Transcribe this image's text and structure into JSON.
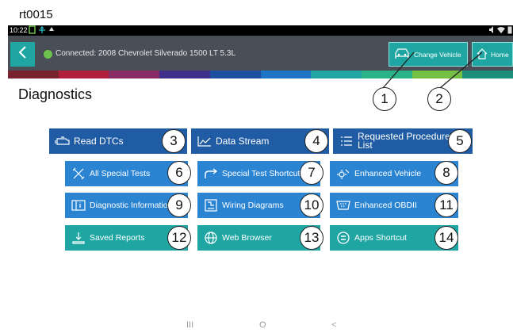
{
  "document": {
    "title": "rt0015"
  },
  "statusbar": {
    "time": "10:22"
  },
  "appbar": {
    "connection_text": "Connected: 2008 Chevrolet Silverado 1500 LT 5.3L",
    "change_vehicle_label": "Change Vehicle",
    "home_label": "Home"
  },
  "page": {
    "title": "Diagnostics"
  },
  "tiles": {
    "read_dtcs": "Read DTCs",
    "data_stream": "Data Stream",
    "requested_procedures": "Requested Procedures List",
    "all_special_tests": "All Special Tests",
    "special_test_shortcuts": "Special Test Shortcuts",
    "enhanced_vehicle": "Enhanced Vehicle",
    "diagnostic_information": "Diagnostic Information",
    "wiring_diagrams": "Wiring Diagrams",
    "enhanced_obdii": "Enhanced OBDII",
    "saved_reports": "Saved Reports",
    "web_browser": "Web Browser",
    "apps_shortcut": "Apps Shortcut"
  },
  "callouts": [
    "1",
    "2",
    "3",
    "4",
    "5",
    "6",
    "7",
    "8",
    "9",
    "10",
    "11",
    "12",
    "13",
    "14"
  ],
  "navbar": {
    "recents": "III",
    "home": "O",
    "back": "<"
  },
  "colors": {
    "appbar": "#4a4f57",
    "accent_teal": "#1fa6a3",
    "tile_dark_blue": "#1f5ca3",
    "tile_blue": "#2a84d2",
    "connected_green": "#6cc24a"
  },
  "icons": {
    "back": "chevron-left-icon",
    "change_vehicle": "car-front-icon",
    "home": "home-icon",
    "read_dtcs": "engine-icon",
    "data_stream": "line-graph-icon",
    "requested_procedures": "list-icon",
    "all_special_tests": "wrench-screwdriver-icon",
    "special_test_shortcuts": "shortcut-arrow-icon",
    "enhanced_vehicle": "vehicle-gear-icon",
    "diagnostic_information": "info-book-icon",
    "wiring_diagrams": "wiring-diagram-icon",
    "enhanced_obdii": "obd-connector-icon",
    "saved_reports": "download-tray-icon",
    "web_browser": "globe-icon",
    "apps_shortcut": "apps-icon"
  }
}
